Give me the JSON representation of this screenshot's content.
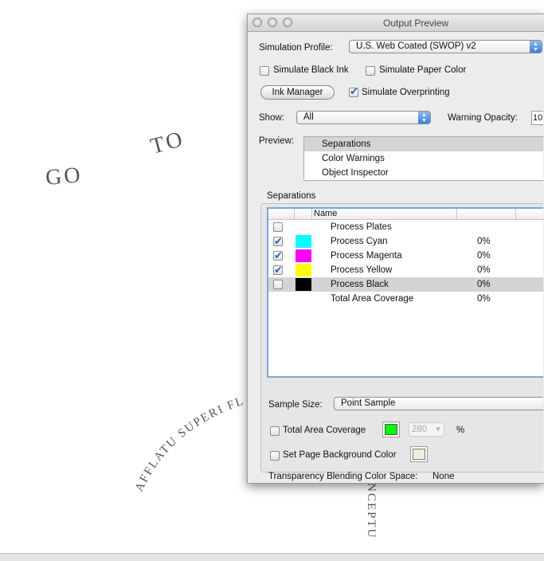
{
  "canvas": {
    "words": [
      "GO",
      "TO",
      "AFFLATU SUPERI FL",
      "NCEPTU"
    ]
  },
  "window": {
    "title": "Output Preview"
  },
  "simulation_profile": {
    "label": "Simulation Profile:",
    "value": "U.S. Web Coated (SWOP) v2"
  },
  "simulate_black_ink": {
    "label": "Simulate Black Ink",
    "checked": false
  },
  "simulate_paper_color": {
    "label": "Simulate Paper Color",
    "checked": false
  },
  "ink_manager": {
    "label": "Ink Manager"
  },
  "simulate_overprinting": {
    "label": "Simulate Overprinting",
    "checked": true
  },
  "show": {
    "label": "Show:",
    "value": "All"
  },
  "warning_opacity": {
    "label": "Warning Opacity:",
    "value": "10"
  },
  "preview": {
    "label": "Preview:",
    "items": [
      "Separations",
      "Color Warnings",
      "Object Inspector"
    ],
    "selected": "Separations"
  },
  "separations": {
    "label": "Separations",
    "columns": [
      "",
      "",
      "Name",
      "",
      ""
    ],
    "rows": [
      {
        "name": "Process Plates",
        "checked": false,
        "color": null,
        "value": ""
      },
      {
        "name": "Process Cyan",
        "checked": true,
        "color": "#00ffff",
        "value": "0%"
      },
      {
        "name": "Process Magenta",
        "checked": true,
        "color": "#ff00ff",
        "value": "0%"
      },
      {
        "name": "Process Yellow",
        "checked": true,
        "color": "#ffff00",
        "value": "0%"
      },
      {
        "name": "Process Black",
        "checked": false,
        "color": "#000000",
        "value": "0%",
        "selected": true
      },
      {
        "name": "Total Area Coverage",
        "checked": null,
        "color": null,
        "value": "0%"
      }
    ]
  },
  "sample_size": {
    "label": "Sample Size:",
    "value": "Point Sample"
  },
  "total_area_coverage": {
    "label": "Total Area Coverage",
    "checked": false,
    "color": "#00ff00",
    "value": "280",
    "unit": "%"
  },
  "page_background": {
    "label": "Set Page Background Color",
    "checked": false,
    "color": "#eeeedd"
  },
  "blending": {
    "label": "Transparency Blending Color Space:",
    "value": "None"
  }
}
